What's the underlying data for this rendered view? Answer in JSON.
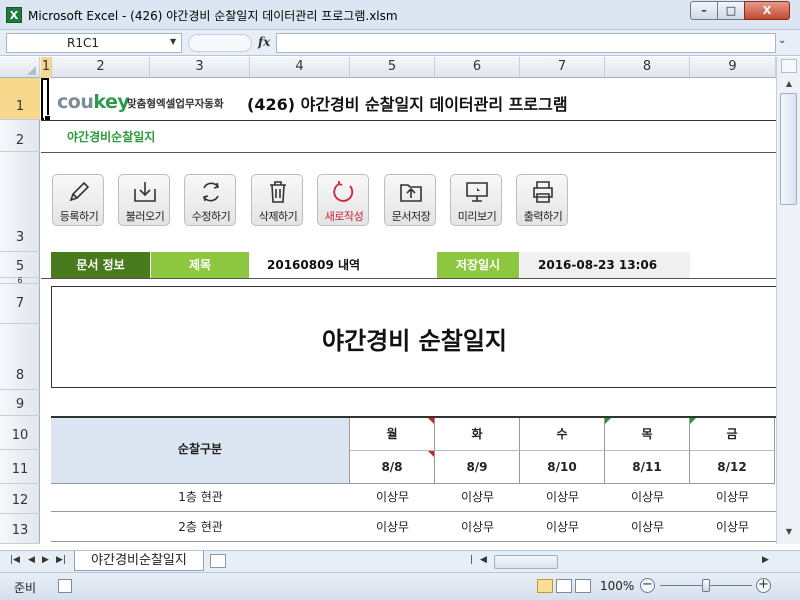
{
  "window": {
    "title": "Microsoft Excel - (426) 야간경비 순찰일지 데이터관리 프로그램.xlsm",
    "app_icon": "X",
    "minimize": "–",
    "maximize": "□",
    "close": "X"
  },
  "formula_bar": {
    "name_box": "R1C1",
    "fx_label": "fx",
    "formula": ""
  },
  "columns": [
    "1",
    "2",
    "3",
    "4",
    "5",
    "6",
    "7",
    "8",
    "9"
  ],
  "rows": [
    "1",
    "2",
    "3",
    "5",
    "6",
    "7",
    "8",
    "9",
    "10",
    "11",
    "12",
    "13"
  ],
  "header": {
    "logo_main": "cou",
    "logo_accent": "key",
    "tagline": "맞춤형엑셀업무자동화",
    "title": "(426) 야간경비 순찰일지 데이터관리 프로그램",
    "subtitle": "야간경비순찰일지"
  },
  "toolbar": [
    {
      "label": "등록하기",
      "icon": "pencil-icon"
    },
    {
      "label": "불러오기",
      "icon": "download-icon"
    },
    {
      "label": "수정하기",
      "icon": "refresh-icon"
    },
    {
      "label": "삭제하기",
      "icon": "trash-icon"
    },
    {
      "label": "새로작성",
      "icon": "new-icon"
    },
    {
      "label": "문서저장",
      "icon": "folder-upload-icon"
    },
    {
      "label": "미리보기",
      "icon": "monitor-icon"
    },
    {
      "label": "출력하기",
      "icon": "printer-icon"
    }
  ],
  "info": {
    "doc_label": "문서 정보",
    "title_label": "제목",
    "title_value": "20160809 내역",
    "saved_label": "저장일시",
    "saved_value": "2016-08-23 13:06"
  },
  "document": {
    "title": "야간경비 순찰일지"
  },
  "table": {
    "category_header": "순찰구분",
    "days": [
      "월",
      "화",
      "수",
      "목",
      "금"
    ],
    "dates": [
      "8/8",
      "8/9",
      "8/10",
      "8/11",
      "8/12"
    ],
    "rows": [
      {
        "category": "1층 현관",
        "cells": [
          "이상무",
          "이상무",
          "이상무",
          "이상무",
          "이상무"
        ]
      },
      {
        "category": "2층 현관",
        "cells": [
          "이상무",
          "이상무",
          "이상무",
          "이상무",
          "이상무"
        ]
      }
    ]
  },
  "sheet_tab": {
    "name": "야간경비순찰일지"
  },
  "status": {
    "ready": "준비",
    "zoom": "100%",
    "zoom_out": "−",
    "zoom_in": "+"
  },
  "colors": {
    "doc_label_bg": "#4a7a1e",
    "accent_green": "#8dc63f",
    "subtitle_green": "#2b9a3a",
    "table_header_bg": "#dce6f2",
    "new_button_red": "#c6273a"
  }
}
